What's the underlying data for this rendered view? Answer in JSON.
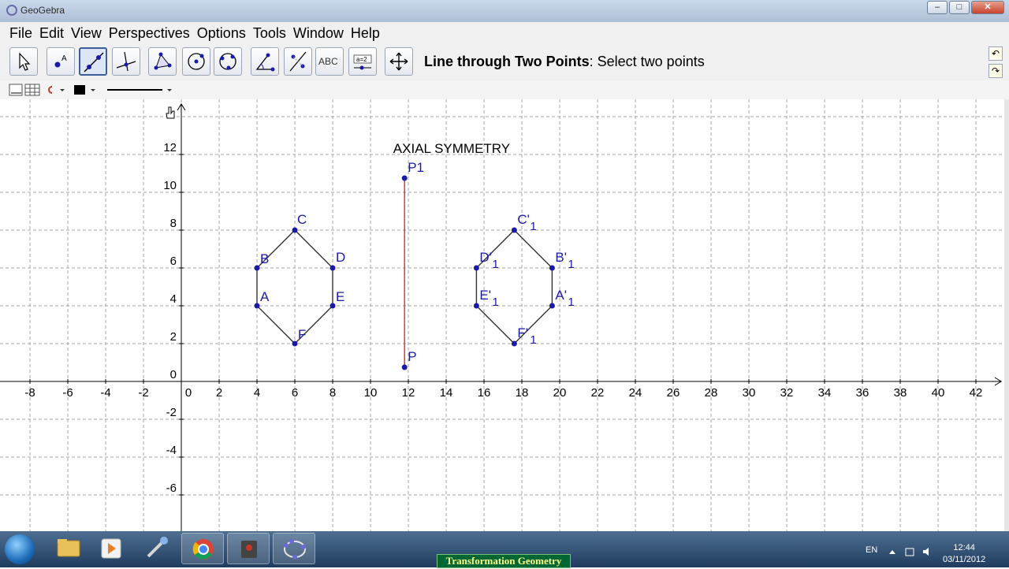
{
  "window": {
    "title": "GeoGebra",
    "buttons": {
      "minimize": "–",
      "maximize": "□",
      "close": "✕"
    }
  },
  "menu": [
    "File",
    "Edit",
    "View",
    "Perspectives",
    "Options",
    "Tools",
    "Window",
    "Help"
  ],
  "toolbar": {
    "tools": [
      "move-tool",
      "point-tool",
      "line-tool",
      "perpendicular-line-tool",
      "polygon-tool",
      "circle-tool",
      "circle-three-points-tool",
      "angle-tool",
      "reflect-tool",
      "text-tool",
      "slider-tool",
      "move-graphics-tool"
    ],
    "active_tool": "line-tool",
    "text_tool_label": "ABC",
    "slider_tool_label": "a=2",
    "help_bold": "Line through Two Points",
    "help_rest": ": Select two points"
  },
  "graphics": {
    "title_label": "AXIAL SYMMETRY",
    "x_ticks": [
      "-8",
      "-6",
      "-4",
      "-2",
      "0",
      "2",
      "4",
      "6",
      "8",
      "10",
      "12",
      "14",
      "16",
      "18",
      "20",
      "22",
      "24",
      "26",
      "28",
      "30",
      "32",
      "34",
      "36",
      "38",
      "40",
      "42"
    ],
    "y_ticks": [
      "12",
      "10",
      "8",
      "6",
      "4",
      "2",
      "0",
      "-2",
      "-4",
      "-6"
    ],
    "points": [
      {
        "name": "A",
        "x": 4,
        "y": 4
      },
      {
        "name": "B",
        "x": 4,
        "y": 6
      },
      {
        "name": "C",
        "x": 6,
        "y": 8
      },
      {
        "name": "D",
        "x": 8,
        "y": 6
      },
      {
        "name": "E",
        "x": 8,
        "y": 4
      },
      {
        "name": "F",
        "x": 6,
        "y": 2
      },
      {
        "name": "P",
        "x": 11.8,
        "y": 0.75
      },
      {
        "name": "P1",
        "x": 11.8,
        "y": 10.75
      }
    ],
    "image_points": [
      {
        "name": "A'",
        "sub": "1",
        "x": 19.6,
        "y": 4
      },
      {
        "name": "B'",
        "sub": "1",
        "x": 19.6,
        "y": 6
      },
      {
        "name": "C'",
        "sub": "1",
        "x": 17.6,
        "y": 8
      },
      {
        "name": "D'",
        "sub": "1",
        "x": 15.6,
        "y": 6
      },
      {
        "name": "E'",
        "sub": "1",
        "x": 15.6,
        "y": 4
      },
      {
        "name": "F'",
        "sub": "1",
        "x": 17.6,
        "y": 2
      }
    ],
    "colors": {
      "point": "#1a1aa8",
      "polygon": "#333333",
      "mirror": "#c0392b",
      "grid": "#a6a6a6",
      "axis": "#000000"
    }
  },
  "taskbar": {
    "banner": "Transformation Geometry",
    "lang": "EN",
    "time": "12:44",
    "date": "03/11/2012"
  }
}
